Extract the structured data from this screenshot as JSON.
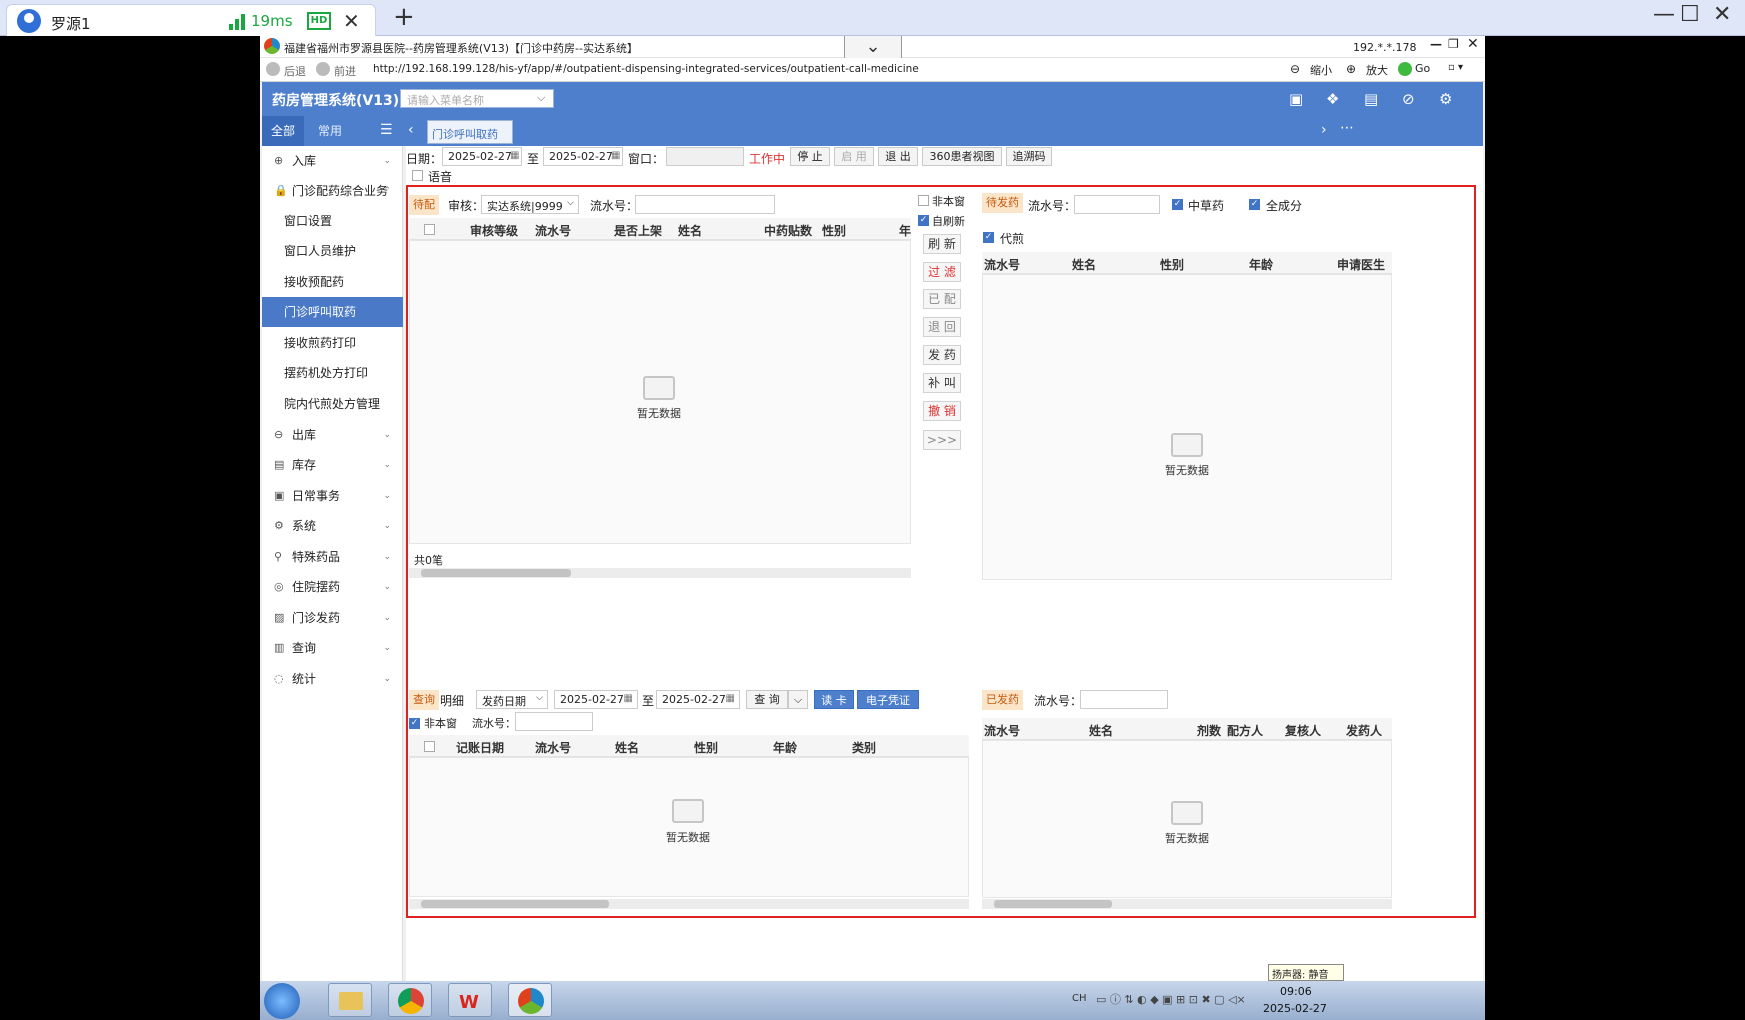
{
  "outer": {
    "tab_title": "罗源1",
    "ping": "19ms",
    "hd": "HD",
    "close": "✕",
    "add": "+",
    "minimize": "—",
    "maximize": "☐",
    "close_window": "✕"
  },
  "window": {
    "title": "福建省福州市罗源县医院--药房管理系统(V13)【门诊中药房--实达系统】",
    "ip": "192.*.*.178",
    "back": "后退",
    "forward": "前进",
    "url": "http://192.168.199.128/his-yf/app/#/outpatient-dispensing-integrated-services/outpatient-call-medicine",
    "zoom_out": "缩小",
    "zoom_in": "放大",
    "go": "Go"
  },
  "app": {
    "name": "药房管理系统(V13)",
    "menu_search_placeholder": "请输入菜单名称",
    "tab_all": "全部",
    "tab_common": "常用",
    "page_tab": "门诊呼叫取药"
  },
  "sidebar": {
    "items": [
      {
        "label": "入库",
        "icon": "⊕"
      },
      {
        "label": "门诊配药综合业务",
        "icon": "🔒"
      },
      {
        "label": "出库",
        "icon": "⊖"
      },
      {
        "label": "库存",
        "icon": "▤"
      },
      {
        "label": "日常事务",
        "icon": "▣"
      },
      {
        "label": "系统",
        "icon": "⚙"
      },
      {
        "label": "特殊药品",
        "icon": "⚲"
      },
      {
        "label": "住院摆药",
        "icon": "◎"
      },
      {
        "label": "门诊发药",
        "icon": "▨"
      },
      {
        "label": "查询",
        "icon": "▥"
      },
      {
        "label": "统计",
        "icon": "◌"
      }
    ],
    "sub_items": [
      "窗口设置",
      "窗口人员维护",
      "接收预配药",
      "门诊呼叫取药",
      "接收煎药打印",
      "摆药机处方打印",
      "院内代煎处方管理"
    ]
  },
  "toolbar": {
    "date_label": "日期：",
    "date_from": "2025-02-27",
    "to": "至",
    "date_to": "2025-02-27",
    "window_label": "窗口：",
    "working": "工作中",
    "stop": "停 止",
    "enable": "启 用",
    "exit": "退 出",
    "view360": "360患者视图",
    "trace": "追溯码",
    "voice": "语音"
  },
  "panel_pending": {
    "tag": "待配",
    "review_label": "审核：",
    "review_value": "实达系统|9999",
    "serial_label": "流水号：",
    "columns": [
      "审核等级",
      "流水号",
      "是否上架",
      "姓名",
      "中药贴数",
      "性别",
      "年"
    ],
    "empty": "暂无数据",
    "total": "共0笔"
  },
  "mid_controls": {
    "non_window": "非本窗",
    "auto_refresh": "自刷新",
    "buttons": [
      "刷 新",
      "过 滤",
      "已 配",
      "退 回",
      "发 药",
      "补 叫",
      "撤 销",
      ">>>"
    ]
  },
  "panel_to_dispense": {
    "tag": "待发药",
    "serial_label": "流水号：",
    "herbal": "中草药",
    "all_ingredients": "全成分",
    "decoct": "代煎",
    "columns": [
      "流水号",
      "姓名",
      "性别",
      "年龄",
      "申请医生"
    ],
    "empty": "暂无数据"
  },
  "panel_query": {
    "tag": "查询",
    "detail": "明细",
    "date_type": "发药日期",
    "date_from": "2025-02-27",
    "to": "至",
    "date_to": "2025-02-27",
    "query": "查 询",
    "read_card": "读 卡",
    "e_voucher": "电子凭证",
    "non_window": "非本窗",
    "serial_label": "流水号：",
    "columns": [
      "记账日期",
      "流水号",
      "姓名",
      "性别",
      "年龄",
      "类别"
    ],
    "empty": "暂无数据"
  },
  "panel_dispensed": {
    "tag": "已发药",
    "serial_label": "流水号：",
    "columns": [
      "流水号",
      "姓名",
      "剂数",
      "配方人",
      "复核人",
      "发药人"
    ],
    "empty": "暂无数据"
  },
  "taskbar": {
    "tooltip": "扬声器: 静音",
    "time": "09:06",
    "date": "2025-02-27",
    "tray_lang": "CH"
  }
}
